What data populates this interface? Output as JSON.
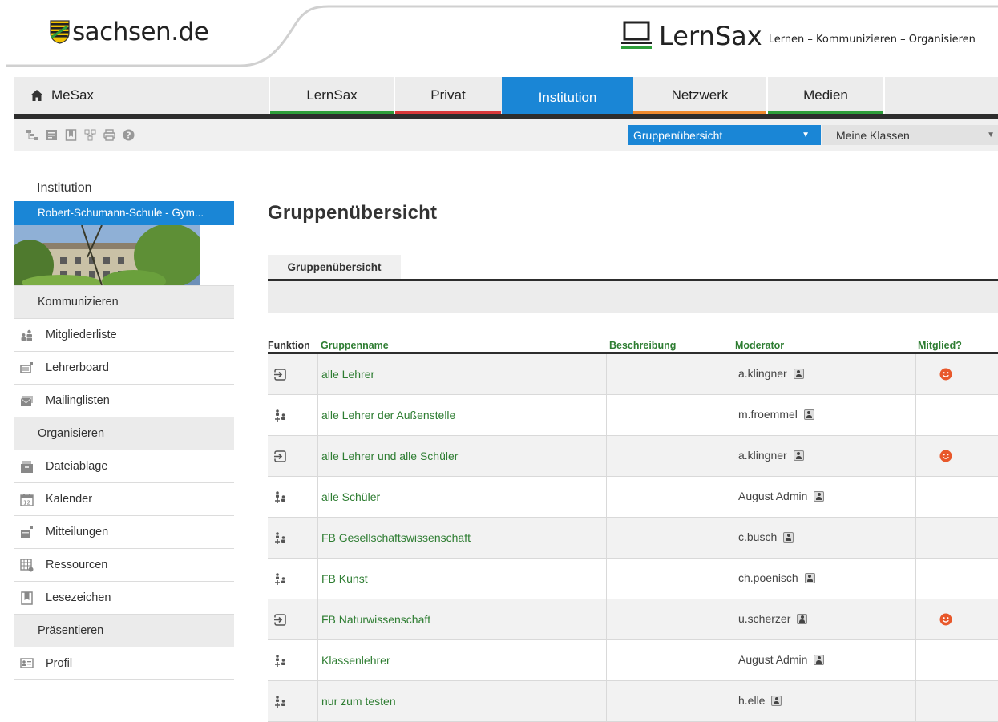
{
  "header": {
    "sachsen_logo_text": "sachsen.de",
    "lernsax_name": "LernSax",
    "lernsax_tagline": "Lernen – Kommunizieren – Organisieren"
  },
  "mainnav": {
    "home_label": "MeSax",
    "tabs": [
      {
        "label": "LernSax",
        "underline_color": "#2e9e3a"
      },
      {
        "label": "Privat",
        "underline_color": "#d9383a"
      },
      {
        "label": "Institution",
        "underline_color": "#1a86d6",
        "active": true
      },
      {
        "label": "Netzwerk",
        "underline_color": "#ef8a2e"
      },
      {
        "label": "Medien",
        "underline_color": "#2e9e3a"
      }
    ]
  },
  "toolbar": {
    "icons": [
      "sitemap-icon",
      "notes-icon",
      "bookmark-icon",
      "network-icon",
      "print-icon",
      "help-icon"
    ],
    "view_select": "Gruppenübersicht",
    "class_select": "Meine Klassen"
  },
  "sidebar": {
    "title": "Institution",
    "school": "Robert-Schumann-Schule - Gym...",
    "sections": [
      {
        "label": "Kommunizieren",
        "items": [
          {
            "label": "Mitgliederliste",
            "icon": "members-icon"
          },
          {
            "label": "Lehrerboard",
            "icon": "board-icon"
          },
          {
            "label": "Mailinglisten",
            "icon": "mail-icon"
          }
        ]
      },
      {
        "label": "Organisieren",
        "items": [
          {
            "label": "Dateiablage",
            "icon": "folder-icon"
          },
          {
            "label": "Kalender",
            "icon": "calendar-icon"
          },
          {
            "label": "Mitteilungen",
            "icon": "message-icon"
          },
          {
            "label": "Ressourcen",
            "icon": "resources-icon"
          },
          {
            "label": "Lesezeichen",
            "icon": "bookmark-icon"
          }
        ]
      },
      {
        "label": "Präsentieren",
        "items": [
          {
            "label": "Profil",
            "icon": "profile-icon"
          }
        ]
      }
    ]
  },
  "main": {
    "title": "Gruppenübersicht",
    "subtab": "Gruppenübersicht",
    "columns": {
      "funktion": "Funktion",
      "gruppenname": "Gruppenname",
      "beschreibung": "Beschreibung",
      "moderator": "Moderator",
      "mitglied": "Mitglied?"
    },
    "rows": [
      {
        "function_icon": "enter-icon",
        "name": "alle Lehrer",
        "moderator": "a.klingner",
        "member": true
      },
      {
        "function_icon": "join-icon",
        "name": "alle Lehrer der Außenstelle",
        "moderator": "m.froemmel",
        "member": false
      },
      {
        "function_icon": "enter-icon",
        "name": "alle Lehrer und alle Schüler",
        "moderator": "a.klingner",
        "member": true
      },
      {
        "function_icon": "join-icon",
        "name": "alle Schüler",
        "moderator": "August Admin",
        "member": false
      },
      {
        "function_icon": "join-icon",
        "name": "FB Gesellschaftswissenschaft",
        "moderator": "c.busch",
        "member": false
      },
      {
        "function_icon": "join-icon",
        "name": "FB Kunst",
        "moderator": "ch.poenisch",
        "member": false
      },
      {
        "function_icon": "enter-icon",
        "name": "FB Naturwissenschaft",
        "moderator": "u.scherzer",
        "member": true
      },
      {
        "function_icon": "join-icon",
        "name": "Klassenlehrer",
        "moderator": "August Admin",
        "member": false
      },
      {
        "function_icon": "join-icon",
        "name": "nur zum testen",
        "moderator": "h.elle",
        "member": false
      }
    ]
  },
  "colors": {
    "brand_blue": "#1a86d6",
    "link_green": "#2e7d32",
    "member_orange": "#e8582b"
  }
}
